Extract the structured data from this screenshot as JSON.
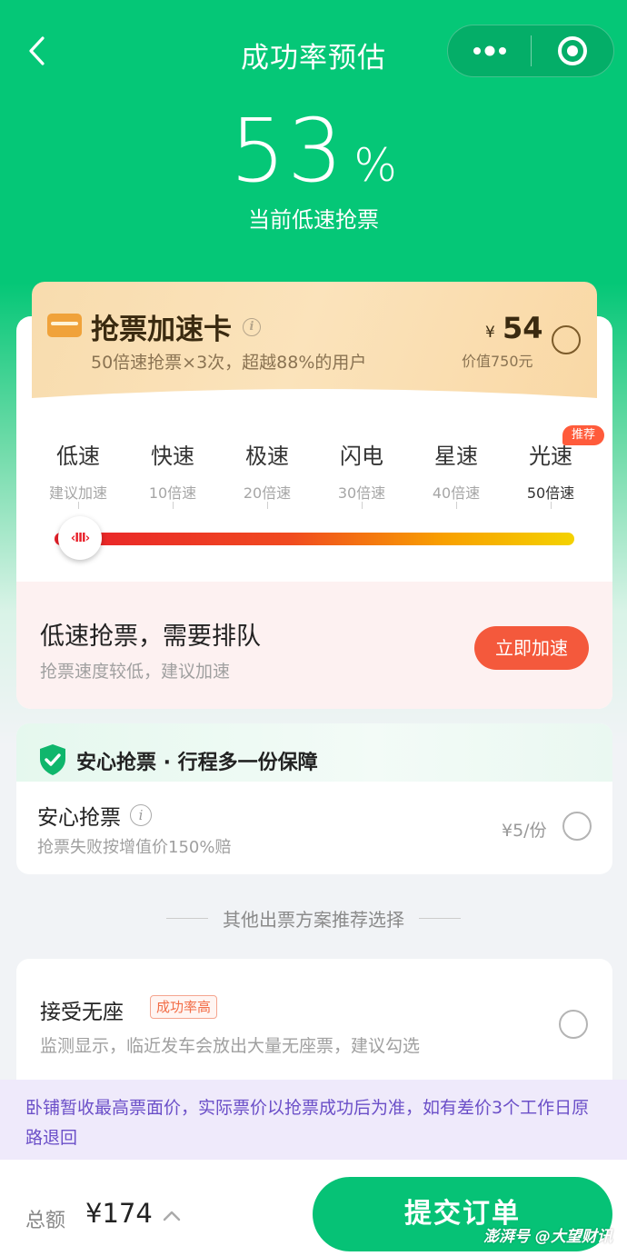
{
  "header": {
    "title": "成功率预估",
    "back_icon": "chevron-left-icon",
    "more_icon": "more-dots-icon",
    "target_icon": "target-icon"
  },
  "rate": {
    "value": "53",
    "unit": "%",
    "subtitle": "当前低速抢票"
  },
  "speed_card": {
    "title": "抢票加速卡",
    "info": "i",
    "subtitle": "50倍速抢票×3次，超越88%的用户",
    "price_currency": "¥",
    "price": "54",
    "value_text": "价值750元",
    "icon": "card-icon"
  },
  "speed_levels": [
    {
      "name": "低速",
      "mult": "建议加速"
    },
    {
      "name": "快速",
      "mult": "10倍速"
    },
    {
      "name": "极速",
      "mult": "20倍速"
    },
    {
      "name": "闪电",
      "mult": "30倍速"
    },
    {
      "name": "星速",
      "mult": "40倍速"
    },
    {
      "name": "光速",
      "mult": "50倍速"
    }
  ],
  "recommend_badge": "推荐",
  "slider_knob": "‹III›",
  "status": {
    "title": "低速抢票，需要排队",
    "subtitle": "抢票速度较低，建议加速",
    "button": "立即加速"
  },
  "insurance": {
    "banner": "安心抢票 · 行程多一份保障",
    "name": "安心抢票",
    "info": "i",
    "desc": "抢票失败按增值价150%赔",
    "price": "¥5/份",
    "icon": "shield-check-icon"
  },
  "divider_text": "其他出票方案推荐选择",
  "no_seat": {
    "title": "接受无座",
    "badge": "成功率高",
    "desc": "监测显示，临近发车会放出大量无座票，建议勾选"
  },
  "notice": "卧铺暂收最高票面价，实际票价以抢票成功后为准，如有差价3个工作日原路退回",
  "footer": {
    "total_label": "总额",
    "total_amount": "¥174",
    "submit": "提交订单",
    "chevron_icon": "chevron-up-icon"
  },
  "watermark": "澎湃号 @大望财讯",
  "colors": {
    "brand_green": "#05c777",
    "accent_red": "#f4593c",
    "gold": "#f8dcae",
    "notice_purple": "#6b4fc8"
  }
}
